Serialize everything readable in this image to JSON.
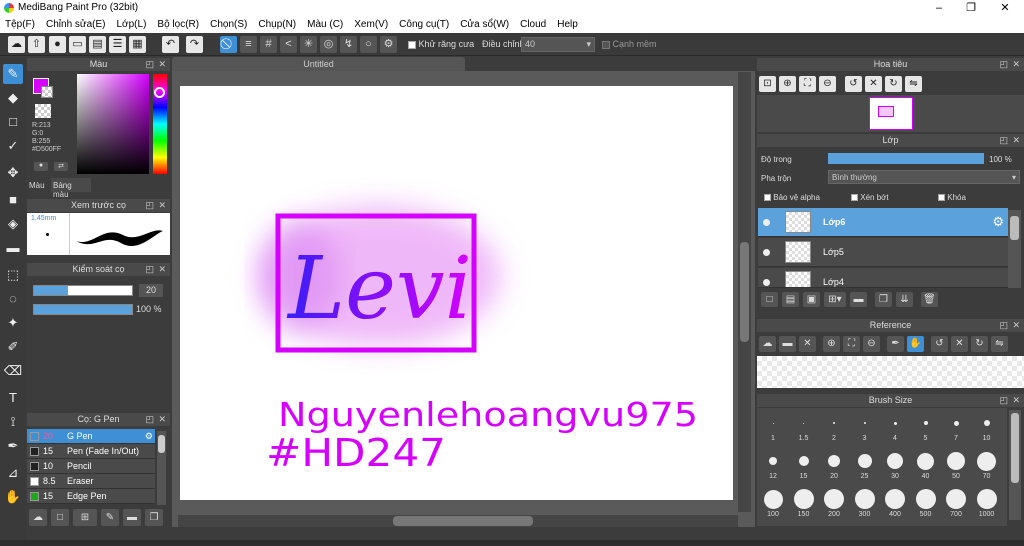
{
  "window": {
    "title": "MediBang Paint Pro (32bit)",
    "minimize": "–",
    "restore": "❐",
    "close": "✕"
  },
  "menu": [
    "Tệp(F)",
    "Chỉnh sửa(E)",
    "Lớp(L)",
    "Bộ lọc(R)",
    "Chọn(S)",
    "Chụp(N)",
    "Màu (C)",
    "Xem(V)",
    "Công cụ(T)",
    "Cửa sổ(W)",
    "Cloud",
    "Help"
  ],
  "toolbar": {
    "antialias_label": "Khử răng cưa",
    "adjust_label": "Điều chỉnh",
    "adjust_value": "40",
    "edge_label": "Cạnh mềm"
  },
  "color_panel": {
    "title": "Màu",
    "r": "R:213",
    "g": "G:0",
    "b": "B:255",
    "hex": "#D500FF",
    "tab_color": "Màu",
    "tab_palette": "Bảng màu",
    "primary": "#d500ff"
  },
  "brush_preview": {
    "title": "Xem trước cọ",
    "size": "1.45mm"
  },
  "brush_control": {
    "title": "Kiểm soát cọ",
    "size_value": "20",
    "size_fill": 0.35,
    "opacity_value": "100 %",
    "opacity_fill": 1.0
  },
  "brush_list": {
    "title": "Cọ: G Pen",
    "items": [
      {
        "size": "20",
        "name": "G Pen",
        "color": "#3d8fd6",
        "selected": true
      },
      {
        "size": "15",
        "name": "Pen (Fade In/Out)",
        "color": "#222"
      },
      {
        "size": "10",
        "name": "Pencil",
        "color": "#222"
      },
      {
        "size": "8.5",
        "name": "Eraser",
        "color": "#fff"
      },
      {
        "size": "15",
        "name": "Edge Pen",
        "color": "#1ba81b"
      }
    ]
  },
  "document": {
    "tab": "Untitled"
  },
  "artwork": {
    "main_text": "Levi",
    "line1": "Nguyenlehoangvu975",
    "line2": "#HD247",
    "ink": "#d500ff"
  },
  "navigator": {
    "title": "Hoa tiêu"
  },
  "layer_panel": {
    "title": "Lớp",
    "opacity_label": "Độ trong",
    "opacity_value": "100 %",
    "opacity_fill": 1.0,
    "blend_label": "Pha trộn",
    "blend_value": "Bình thường",
    "protect_alpha": "Bảo vệ alpha",
    "clipping": "Xén bớt",
    "lock": "Khóa",
    "layers": [
      "Lớp6",
      "Lớp5",
      "Lớp4"
    ]
  },
  "reference": {
    "title": "Reference"
  },
  "brush_size": {
    "title": "Brush Size",
    "sizes": [
      "1",
      "1.5",
      "2",
      "3",
      "4",
      "5",
      "7",
      "10",
      "12",
      "15",
      "20",
      "25",
      "30",
      "40",
      "50",
      "70",
      "100",
      "150",
      "200",
      "300",
      "400",
      "500",
      "700",
      "1000"
    ]
  }
}
